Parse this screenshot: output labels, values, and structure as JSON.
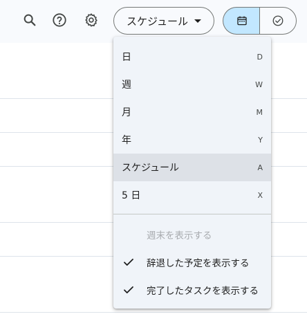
{
  "toolbar": {
    "search_icon": "search-icon",
    "help_icon": "help-icon",
    "settings_icon": "gear-icon",
    "view_select_label": "スケジュール",
    "calendar_toggle_icon": "calendar-icon",
    "tasks_toggle_icon": "check-circle-icon"
  },
  "menu": {
    "items": [
      {
        "label": "日",
        "shortcut": "D"
      },
      {
        "label": "週",
        "shortcut": "W"
      },
      {
        "label": "月",
        "shortcut": "M"
      },
      {
        "label": "年",
        "shortcut": "Y"
      },
      {
        "label": "スケジュール",
        "shortcut": "A"
      },
      {
        "label": "5 日",
        "shortcut": "X"
      }
    ],
    "options": [
      {
        "label": "週末を表示する",
        "checked": false
      },
      {
        "label": "辞退した予定を表示する",
        "checked": true
      },
      {
        "label": "完了したタスクを表示する",
        "checked": true
      }
    ]
  },
  "colors": {
    "accent": "#c2e7ff",
    "menu_bg": "#f0f4f9",
    "selected_bg": "#dde1e7"
  }
}
